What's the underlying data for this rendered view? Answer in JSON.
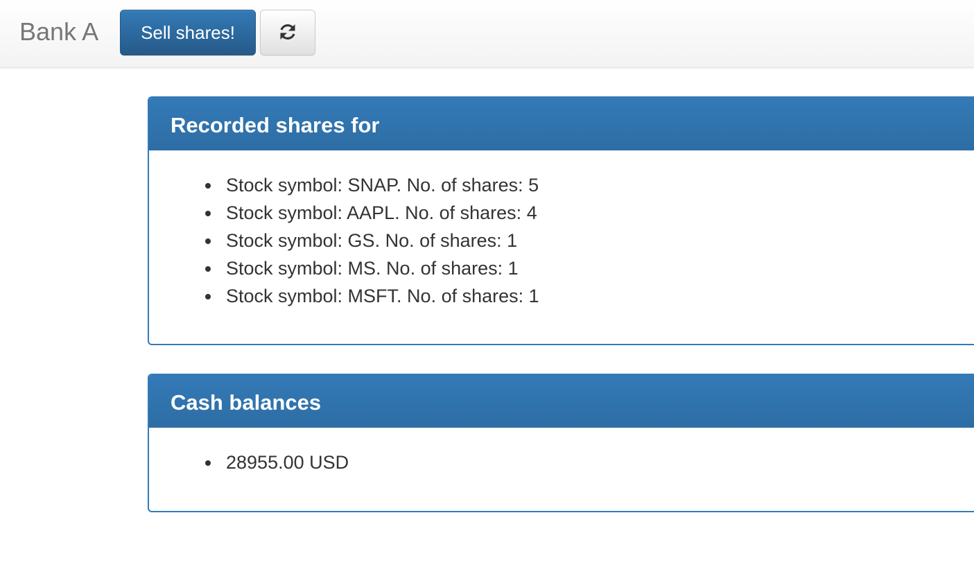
{
  "navbar": {
    "brand": "Bank A",
    "sell_button_label": "Sell shares!",
    "refresh_icon": "refresh-icon"
  },
  "shares_panel": {
    "title": "Recorded shares for",
    "items": [
      "Stock symbol: SNAP. No. of shares: 5",
      "Stock symbol: AAPL. No. of shares: 4",
      "Stock symbol: GS. No. of shares: 1",
      "Stock symbol: MS. No. of shares: 1",
      "Stock symbol: MSFT. No. of shares: 1"
    ]
  },
  "cash_panel": {
    "title": "Cash balances",
    "items": [
      "28955.00 USD"
    ]
  },
  "colors": {
    "primary": "#337ab7",
    "brand_text": "#777777",
    "body_text": "#333333"
  }
}
